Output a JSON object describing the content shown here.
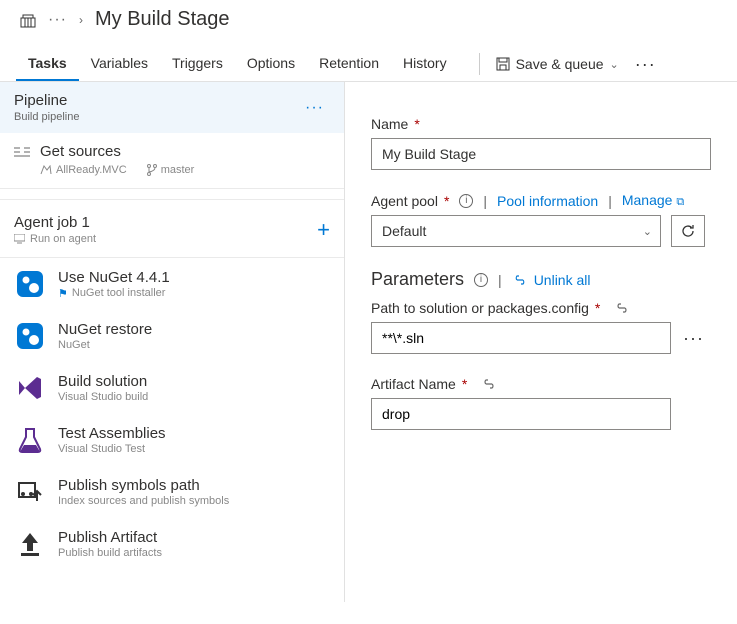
{
  "header": {
    "title": "My Build Stage"
  },
  "tabs": {
    "items": [
      "Tasks",
      "Variables",
      "Triggers",
      "Options",
      "Retention",
      "History"
    ],
    "activeIndex": 0,
    "saveLabel": "Save & queue"
  },
  "left": {
    "pipeline": {
      "title": "Pipeline",
      "subtitle": "Build pipeline"
    },
    "sources": {
      "title": "Get sources",
      "repo": "AllReady.MVC",
      "branch": "master"
    },
    "agent": {
      "title": "Agent job 1",
      "subtitle": "Run on agent"
    },
    "tasks": [
      {
        "title": "Use NuGet 4.4.1",
        "subtitle": "NuGet tool installer",
        "flag": true
      },
      {
        "title": "NuGet restore",
        "subtitle": "NuGet",
        "flag": false
      },
      {
        "title": "Build solution",
        "subtitle": "Visual Studio build",
        "flag": false
      },
      {
        "title": "Test Assemblies",
        "subtitle": "Visual Studio Test",
        "flag": false
      },
      {
        "title": "Publish symbols path",
        "subtitle": "Index sources and publish symbols",
        "flag": false
      },
      {
        "title": "Publish Artifact",
        "subtitle": "Publish build artifacts",
        "flag": false
      }
    ]
  },
  "right": {
    "nameLabel": "Name",
    "nameValue": "My Build Stage",
    "poolLabel": "Agent pool",
    "poolInfoLink": "Pool information",
    "manageLink": "Manage",
    "poolSelected": "Default",
    "paramsTitle": "Parameters",
    "unlinkLabel": "Unlink all",
    "pathLabel": "Path to solution or packages.config",
    "pathValue": "**\\*.sln",
    "artifactLabel": "Artifact Name",
    "artifactValue": "drop"
  }
}
